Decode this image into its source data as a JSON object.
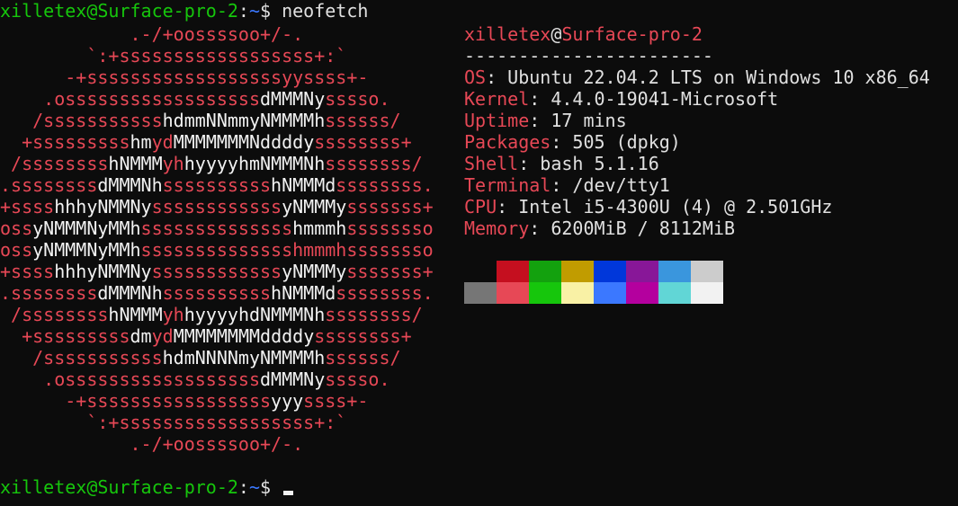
{
  "terminal": {
    "user_host": "xilletex@Surface-pro-2",
    "colon": ":",
    "path": "~",
    "dollar": "$",
    "command": " neofetch"
  },
  "logo": [
    {
      "left": "            ",
      "seg": [
        {
          "t": ".-/+oossssoo+/-.",
          "c": "red"
        }
      ]
    },
    {
      "left": "        ",
      "seg": [
        {
          "t": "`:+ssssssssssssssssss+:`",
          "c": "red"
        }
      ]
    },
    {
      "left": "      ",
      "seg": [
        {
          "t": "-+ssssssssssssssssssyyssss+-",
          "c": "red"
        }
      ]
    },
    {
      "left": "    ",
      "seg": [
        {
          "t": ".ossssssssssssssssss",
          "c": "red"
        },
        {
          "t": "dMMMNy",
          "c": "w"
        },
        {
          "t": "sssso.",
          "c": "red"
        }
      ]
    },
    {
      "left": "   ",
      "seg": [
        {
          "t": "/sssssssssss",
          "c": "red"
        },
        {
          "t": "hdmmNNmmyNMMMMh",
          "c": "w"
        },
        {
          "t": "ssssss/",
          "c": "red"
        }
      ]
    },
    {
      "left": "  ",
      "seg": [
        {
          "t": "+sssssssss",
          "c": "red"
        },
        {
          "t": "hm",
          "c": "w"
        },
        {
          "t": "yd",
          "c": "red"
        },
        {
          "t": "MMMMMMMNddddy",
          "c": "w"
        },
        {
          "t": "ssssssss+",
          "c": "red"
        }
      ]
    },
    {
      "left": " ",
      "seg": [
        {
          "t": "/ssssssss",
          "c": "red"
        },
        {
          "t": "hNMMM",
          "c": "w"
        },
        {
          "t": "yh",
          "c": "red"
        },
        {
          "t": "hyyyyhmNMMMNh",
          "c": "w"
        },
        {
          "t": "ssssssss/",
          "c": "red"
        }
      ]
    },
    {
      "left": "",
      "seg": [
        {
          "t": ".ssssssss",
          "c": "red"
        },
        {
          "t": "dMMMNh",
          "c": "w"
        },
        {
          "t": "ssssssssss",
          "c": "red"
        },
        {
          "t": "hNMMMd",
          "c": "w"
        },
        {
          "t": "ssssssss.",
          "c": "red"
        }
      ]
    },
    {
      "left": "",
      "seg": [
        {
          "t": "+ssss",
          "c": "red"
        },
        {
          "t": "hhhyNMMNy",
          "c": "w"
        },
        {
          "t": "ssssssssssss",
          "c": "red"
        },
        {
          "t": "yNMMMy",
          "c": "w"
        },
        {
          "t": "sssssss+",
          "c": "red"
        }
      ]
    },
    {
      "left": "",
      "seg": [
        {
          "t": "oss",
          "c": "red"
        },
        {
          "t": "yNMMMNyMMh",
          "c": "w"
        },
        {
          "t": "ssssssssssssss",
          "c": "red"
        },
        {
          "t": "hmmmh",
          "c": "w"
        },
        {
          "t": "ssssssso",
          "c": "red"
        }
      ]
    },
    {
      "left": "",
      "seg": [
        {
          "t": "oss",
          "c": "red"
        },
        {
          "t": "yNMMMNyMMh",
          "c": "w"
        },
        {
          "t": "sssssssssssssshmmmhssssssso",
          "c": "red"
        }
      ]
    },
    {
      "left": "",
      "seg": [
        {
          "t": "+ssss",
          "c": "red"
        },
        {
          "t": "hhhyNMMNy",
          "c": "w"
        },
        {
          "t": "ssssssssssss",
          "c": "red"
        },
        {
          "t": "yNMMMy",
          "c": "w"
        },
        {
          "t": "sssssss+",
          "c": "red"
        }
      ]
    },
    {
      "left": "",
      "seg": [
        {
          "t": ".ssssssss",
          "c": "red"
        },
        {
          "t": "dMMMNh",
          "c": "w"
        },
        {
          "t": "ssssssssss",
          "c": "red"
        },
        {
          "t": "hNMMMd",
          "c": "w"
        },
        {
          "t": "ssssssss.",
          "c": "red"
        }
      ]
    },
    {
      "left": " ",
      "seg": [
        {
          "t": "/ssssssss",
          "c": "red"
        },
        {
          "t": "hNMMM",
          "c": "w"
        },
        {
          "t": "yh",
          "c": "red"
        },
        {
          "t": "hyyyyhdNMMMNh",
          "c": "w"
        },
        {
          "t": "ssssssss/",
          "c": "red"
        }
      ]
    },
    {
      "left": "  ",
      "seg": [
        {
          "t": "+sssssssss",
          "c": "red"
        },
        {
          "t": "dm",
          "c": "w"
        },
        {
          "t": "yd",
          "c": "red"
        },
        {
          "t": "MMMMMMMMddddy",
          "c": "w"
        },
        {
          "t": "ssssssss+",
          "c": "red"
        }
      ]
    },
    {
      "left": "   ",
      "seg": [
        {
          "t": "/sssssssssss",
          "c": "red"
        },
        {
          "t": "hdmNNNNmyNMMMMh",
          "c": "w"
        },
        {
          "t": "ssssss/",
          "c": "red"
        }
      ]
    },
    {
      "left": "    ",
      "seg": [
        {
          "t": ".ossssssssssssssssss",
          "c": "red"
        },
        {
          "t": "dMMMNy",
          "c": "w"
        },
        {
          "t": "sssso.",
          "c": "red"
        }
      ]
    },
    {
      "left": "      ",
      "seg": [
        {
          "t": "-+sssssssssssssssss",
          "c": "red"
        },
        {
          "t": "yyy",
          "c": "w"
        },
        {
          "t": "ssss+-",
          "c": "red"
        }
      ]
    },
    {
      "left": "        ",
      "seg": [
        {
          "t": "`:+ssssssssssssssssss+:`",
          "c": "red"
        }
      ]
    },
    {
      "left": "            ",
      "seg": [
        {
          "t": ".-/+oossssoo+/-.",
          "c": "red"
        }
      ]
    }
  ],
  "info": {
    "user": "xilletex",
    "at": "@",
    "host": "Surface-pro-2",
    "separator": "-----------------------",
    "fields": [
      {
        "key": "OS",
        "value": ": Ubuntu 22.04.2 LTS on Windows 10 x86_64"
      },
      {
        "key": "Kernel",
        "value": ": 4.4.0-19041-Microsoft"
      },
      {
        "key": "Uptime",
        "value": ": 17 mins"
      },
      {
        "key": "Packages",
        "value": ": 505 (dpkg)"
      },
      {
        "key": "Shell",
        "value": ": bash 5.1.16"
      },
      {
        "key": "Terminal",
        "value": ": /dev/tty1"
      },
      {
        "key": "CPU",
        "value": ": Intel i5-4300U (4) @ 2.501GHz"
      },
      {
        "key": "Memory",
        "value": ": 6200MiB / 8112MiB"
      }
    ]
  },
  "palette": {
    "top": [
      "#0c0c0c",
      "#c50f1f",
      "#13a10e",
      "#c19c00",
      "#0037da",
      "#881798",
      "#3a96dd",
      "#cccccc"
    ],
    "bottom": [
      "#767676",
      "#e74856",
      "#16c60c",
      "#f9f1a5",
      "#3b78ff",
      "#b4009e",
      "#61d6d6",
      "#f2f2f2"
    ]
  },
  "colors": {
    "prompt_user": "#16c60c",
    "prompt_path": "#3b78ff",
    "accent_red": "#e74856",
    "text": "#cccccc",
    "background": "#0c0c0c"
  }
}
